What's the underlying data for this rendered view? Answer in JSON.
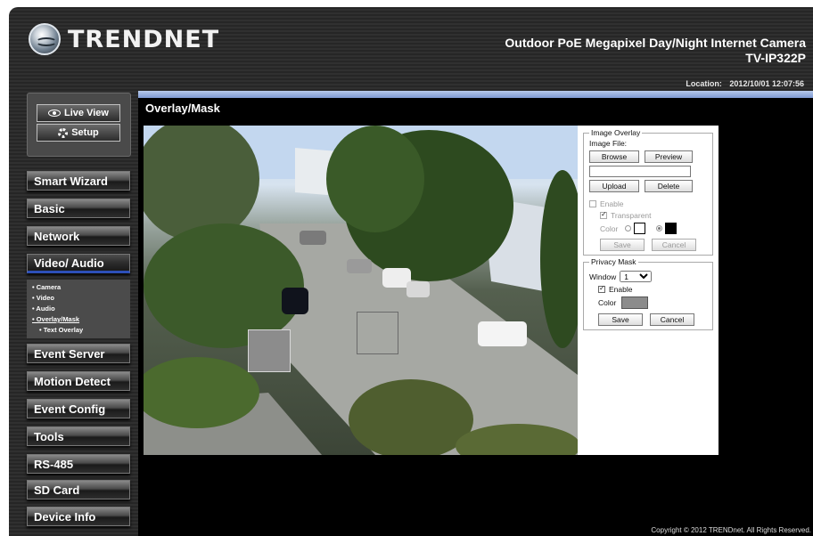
{
  "header": {
    "logo_text": "TRENDNET",
    "product_name": "Outdoor PoE Megapixel Day/Night Internet Camera",
    "model": "TV-IP322P",
    "location_label": "Location:",
    "location_value": "2012/10/01 12:07:56"
  },
  "quick": {
    "live_view": "Live View",
    "setup": "Setup"
  },
  "nav": {
    "smart_wizard": "Smart Wizard",
    "basic": "Basic",
    "network": "Network",
    "video_audio": "Video/ Audio",
    "event_server": "Event Server",
    "motion_detect": "Motion Detect",
    "event_config": "Event Config",
    "tools": "Tools",
    "rs485": "RS-485",
    "sd_card": "SD Card",
    "device_info": "Device Info"
  },
  "submenu": {
    "camera": "• Camera",
    "video": "• Video",
    "audio": "• Audio",
    "overlay_mask": "• Overlay/Mask",
    "text_overlay": "• Text Overlay"
  },
  "page": {
    "title": "Overlay/Mask"
  },
  "image_overlay": {
    "legend": "Image Overlay",
    "image_file_label": "Image File:",
    "browse": "Browse",
    "preview": "Preview",
    "path_value": "",
    "upload": "Upload",
    "delete": "Delete",
    "enable": "Enable",
    "transparent": "Transparent",
    "color_label": "Color",
    "save": "Save",
    "cancel": "Cancel",
    "color_white": "#ffffff",
    "color_black": "#000000"
  },
  "privacy_mask": {
    "legend": "Privacy Mask",
    "window_label": "Window",
    "window_value": "1",
    "enable": "Enable",
    "color_label": "Color",
    "mask_color": "#8c8c8c",
    "save": "Save",
    "cancel": "Cancel"
  },
  "footer": {
    "copyright": "Copyright © 2012 TRENDnet. All Rights Reserved."
  }
}
